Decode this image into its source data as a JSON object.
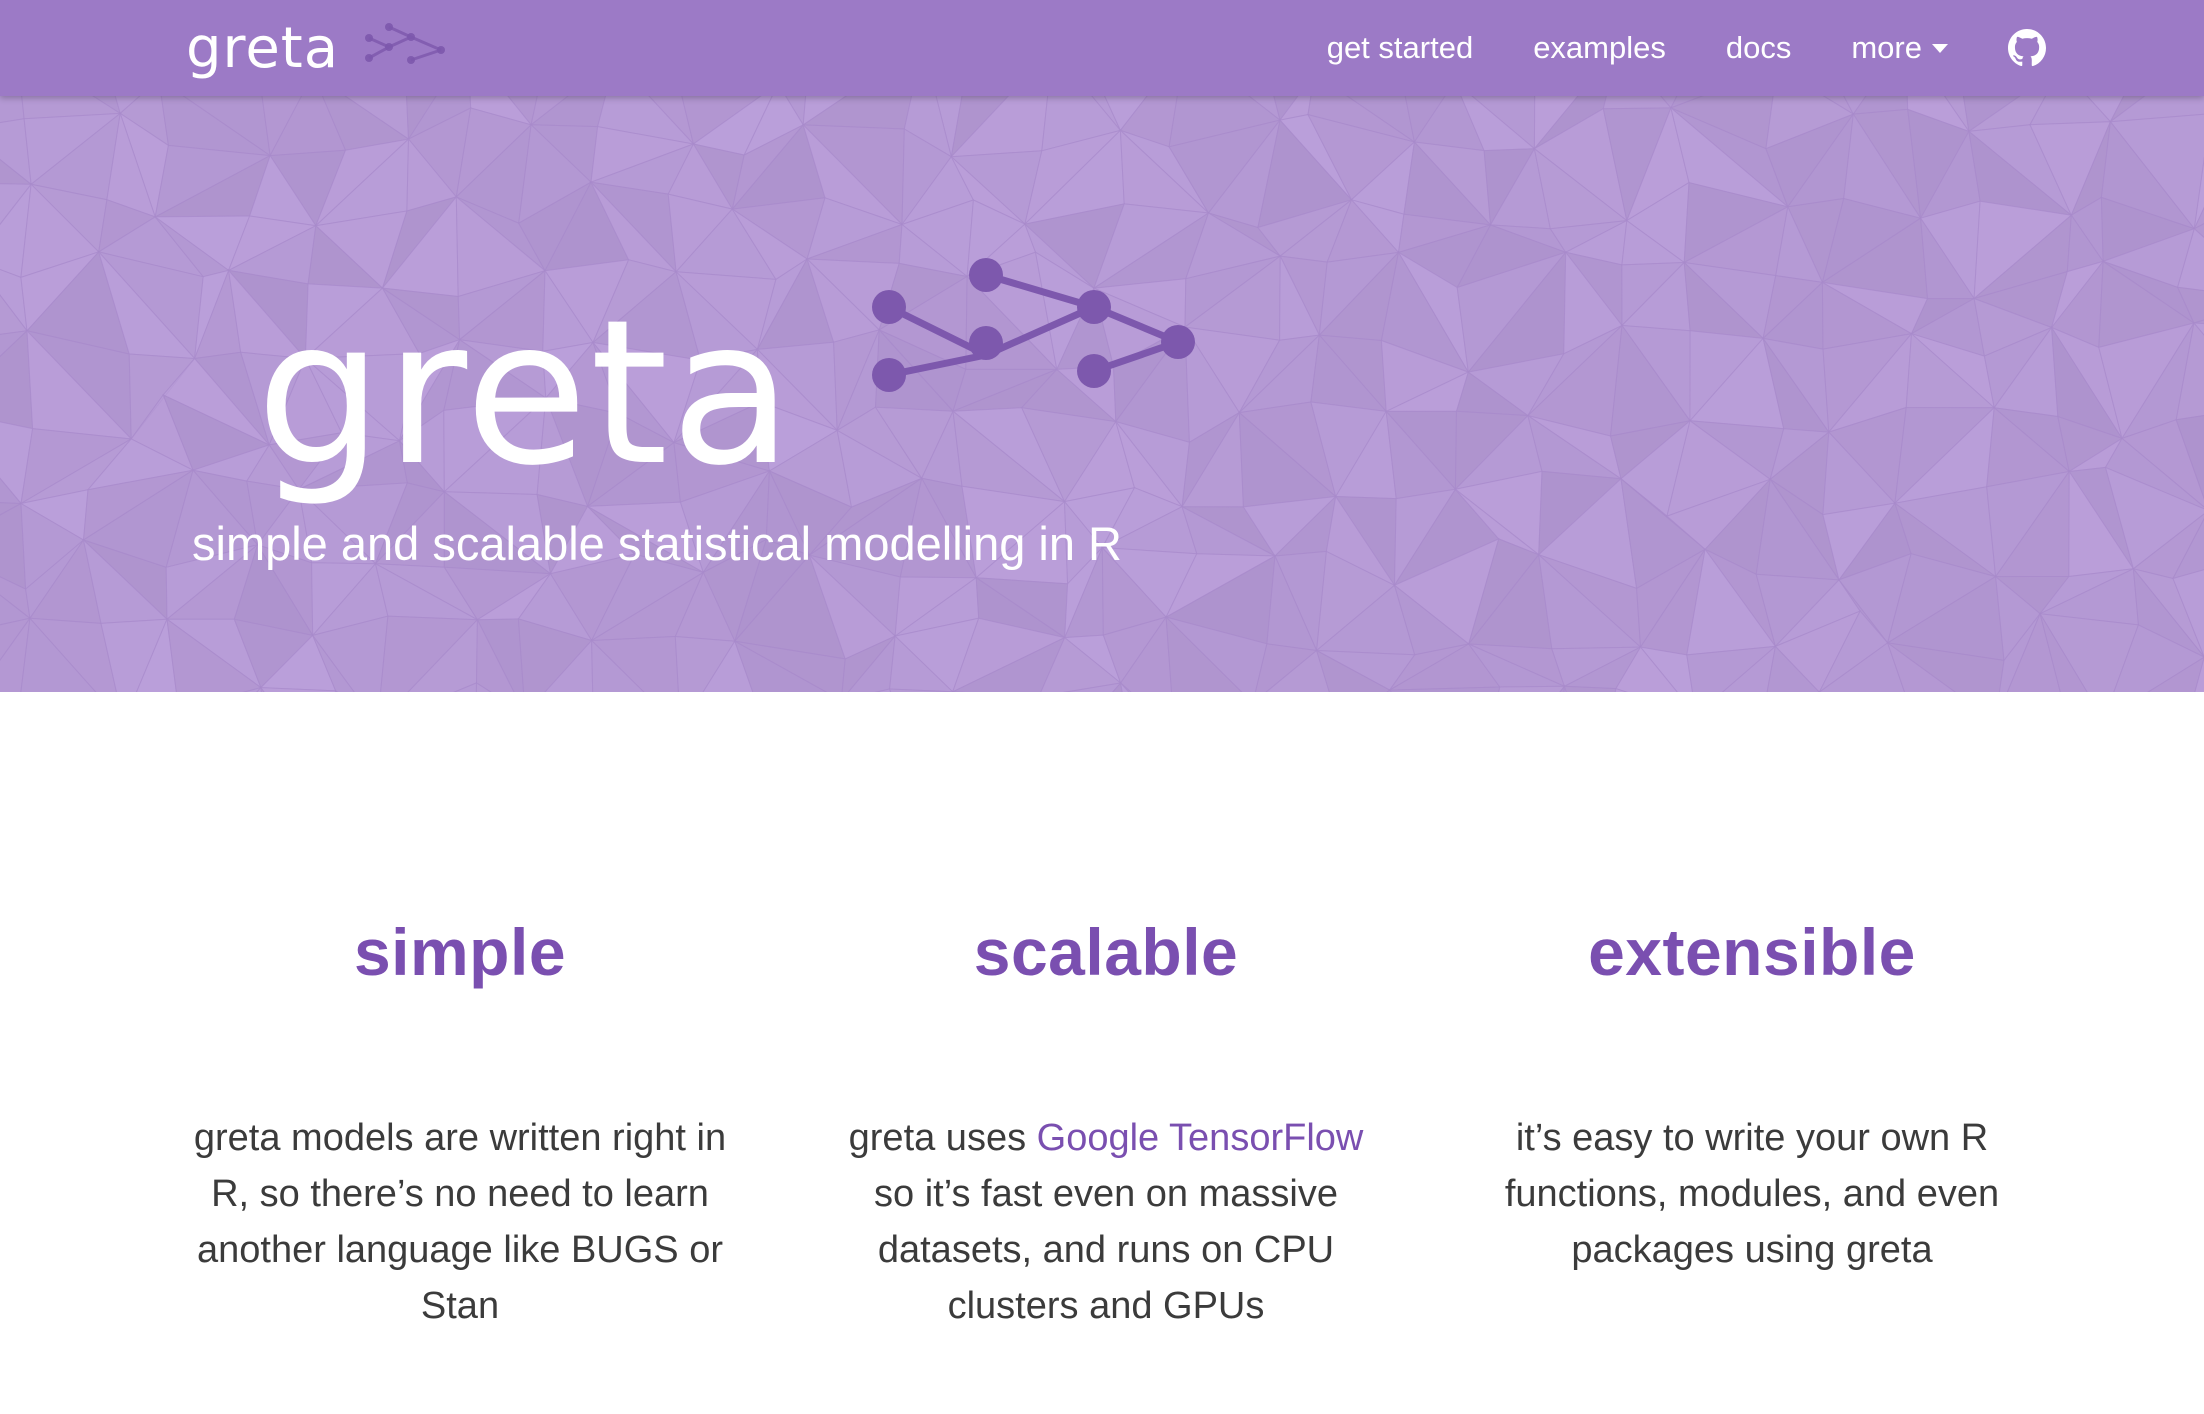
{
  "nav": {
    "brand": "greta",
    "links": [
      {
        "label": "get started"
      },
      {
        "label": "examples"
      },
      {
        "label": "docs"
      },
      {
        "label": "more"
      }
    ],
    "github_icon": "github-icon"
  },
  "hero": {
    "title": "greta",
    "subtitle": "simple and scalable statistical modelling in R"
  },
  "features": [
    {
      "title": "simple",
      "text": "greta models are written right in R, so there’s no need to learn another language like BUGS or Stan"
    },
    {
      "title": "scalable",
      "text_before": "greta uses ",
      "link": "Google TensorFlow",
      "text_after": " so it’s fast even on massive datasets, and runs on CPU clusters and GPUs"
    },
    {
      "title": "extensible",
      "text": "it’s easy to write your own R functions, modules, and even packages using greta"
    }
  ],
  "colors": {
    "navbar": "#9c7ac6",
    "hero_bg": "#b69ad6",
    "accent": "#7a4fb0",
    "body_text": "#3b3b3b"
  }
}
